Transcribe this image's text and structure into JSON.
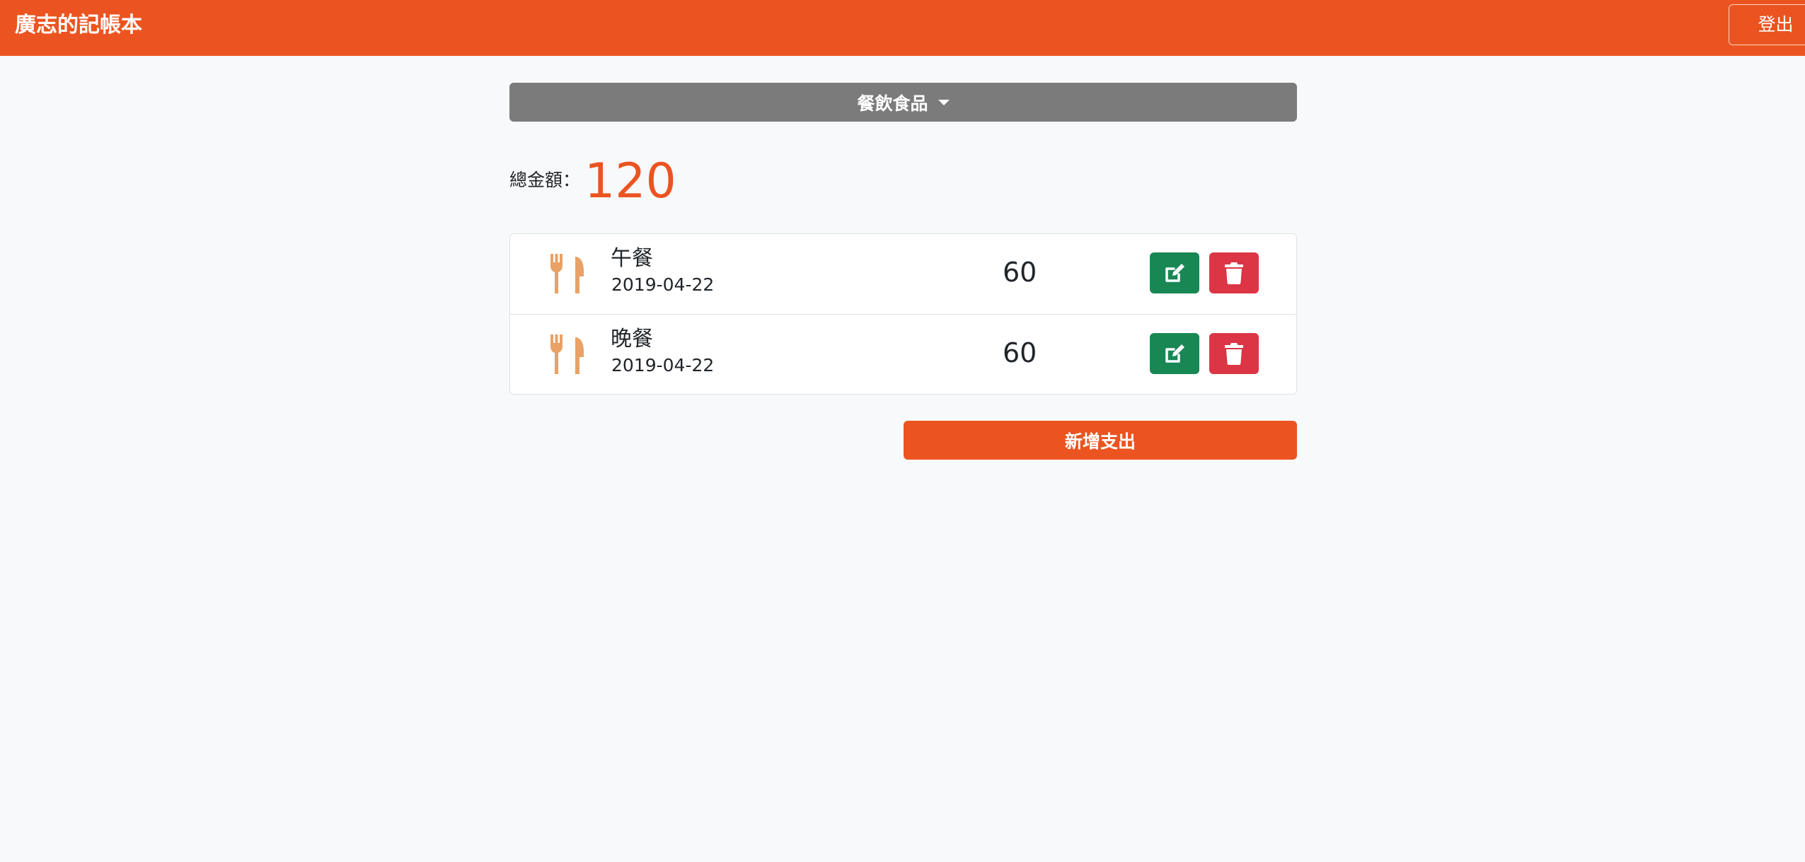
{
  "navbar": {
    "brand": "廣志的記帳本",
    "logout_label": "登出"
  },
  "filter": {
    "selected_category": "餐飲食品"
  },
  "summary": {
    "total_label": "總金額：",
    "total_value": "120"
  },
  "records": [
    {
      "icon": "utensils-icon",
      "name": "午餐",
      "date": "2019-04-22",
      "amount": "60"
    },
    {
      "icon": "utensils-icon",
      "name": "晚餐",
      "date": "2019-04-22",
      "amount": "60"
    }
  ],
  "actions": {
    "add_label": "新增支出"
  },
  "colors": {
    "brand": "#eb5420",
    "icon": "#e9a165",
    "edit": "#198754",
    "delete": "#dc3545",
    "select": "#7b7b7b"
  }
}
